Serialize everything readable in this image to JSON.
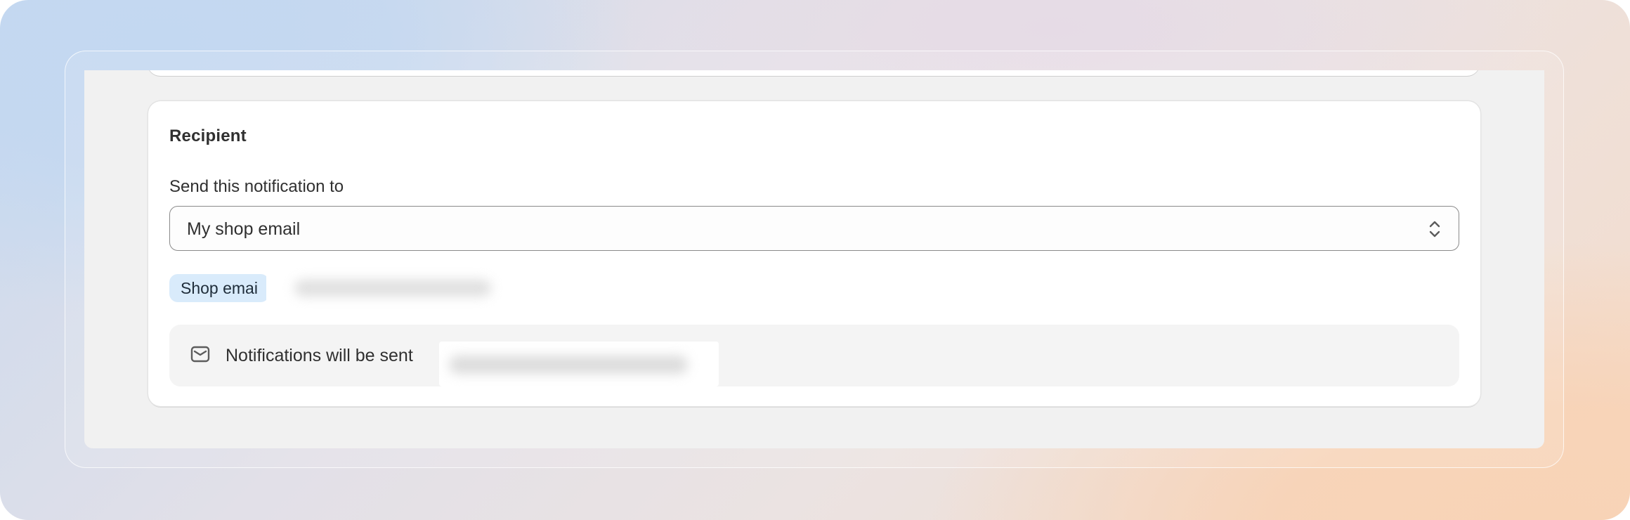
{
  "recipient_card": {
    "title": "Recipient",
    "field_label": "Send this notification to",
    "select": {
      "selected_value": "My shop email"
    },
    "tag": {
      "label": "Shop emai"
    },
    "info_banner": {
      "text": "Notifications will be sent"
    }
  },
  "colors": {
    "tag_background": "#d9ebfb",
    "card_background": "#ffffff",
    "page_background": "#f1f1f1"
  },
  "icons": {
    "banner_icon": "envelope-icon",
    "select_icon": "chevron-up-down-icon"
  }
}
